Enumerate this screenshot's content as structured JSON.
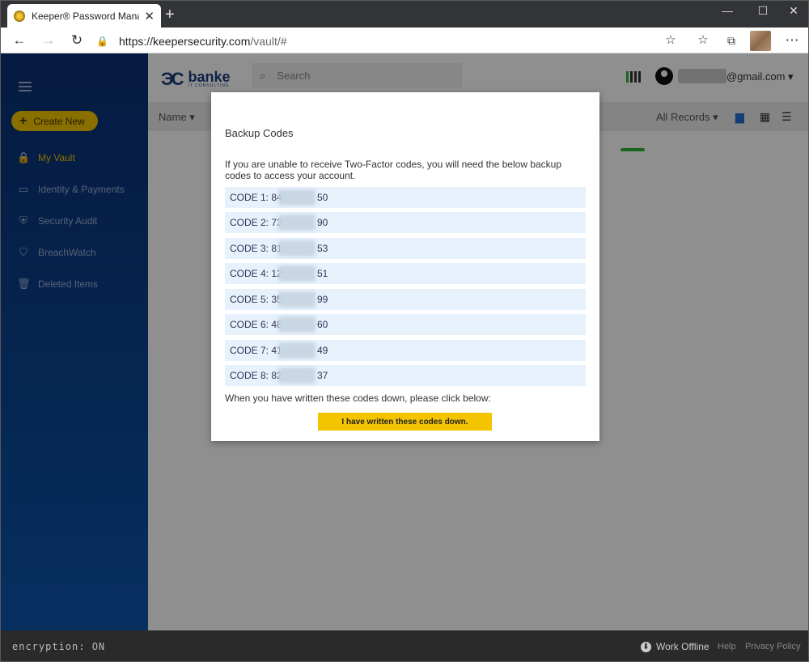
{
  "browser": {
    "tab_title": "Keeper® Password Manager & D",
    "url_main": "https://keepersecurity.com",
    "url_path": "/vault/#",
    "new_tab_icon": "plus-icon",
    "window_controls": [
      "minimize",
      "maximize",
      "close"
    ]
  },
  "sidebar": {
    "create_new": "Create New",
    "items": [
      {
        "label": "My Vault",
        "icon": "lock-icon",
        "active": true
      },
      {
        "label": "Identity & Payments",
        "icon": "card-icon"
      },
      {
        "label": "Security Audit",
        "icon": "shield-icon"
      },
      {
        "label": "BreachWatch",
        "icon": "breachwatch-icon"
      },
      {
        "label": "Deleted Items",
        "icon": "trash-icon"
      }
    ]
  },
  "header": {
    "logo_text": "banke",
    "logo_sub": "IT CONSULTING",
    "search_placeholder": "Search",
    "user_email_suffix": "@gmail.com"
  },
  "toolbar": {
    "name_sort": "Name",
    "filter": "All Records"
  },
  "modal": {
    "title": "Backup Codes",
    "description": "If you are unable to receive Two-Factor codes, you will need the below backup codes to access your account.",
    "codes": [
      {
        "prefix": "CODE 1: 84",
        "suffix": "50"
      },
      {
        "prefix": "CODE 2: 73",
        "suffix": "90"
      },
      {
        "prefix": "CODE 3: 81",
        "suffix": "53"
      },
      {
        "prefix": "CODE 4: 12",
        "suffix": "51"
      },
      {
        "prefix": "CODE 5: 35",
        "suffix": "99"
      },
      {
        "prefix": "CODE 6: 48",
        "suffix": "60"
      },
      {
        "prefix": "CODE 7: 41",
        "suffix": "49"
      },
      {
        "prefix": "CODE 8: 82",
        "suffix": "37"
      }
    ],
    "footer_text": "When you have written these codes down, please click below:",
    "confirm_button": "I have written these codes down."
  },
  "footer": {
    "encryption": "encryption: ON",
    "work_offline": "Work Offline",
    "help": "Help",
    "privacy": "Privacy Policy"
  },
  "colors": {
    "accent_yellow": "#f5c400",
    "sidebar_blue": "#0b4593",
    "code_bg": "#e6f1fc"
  }
}
